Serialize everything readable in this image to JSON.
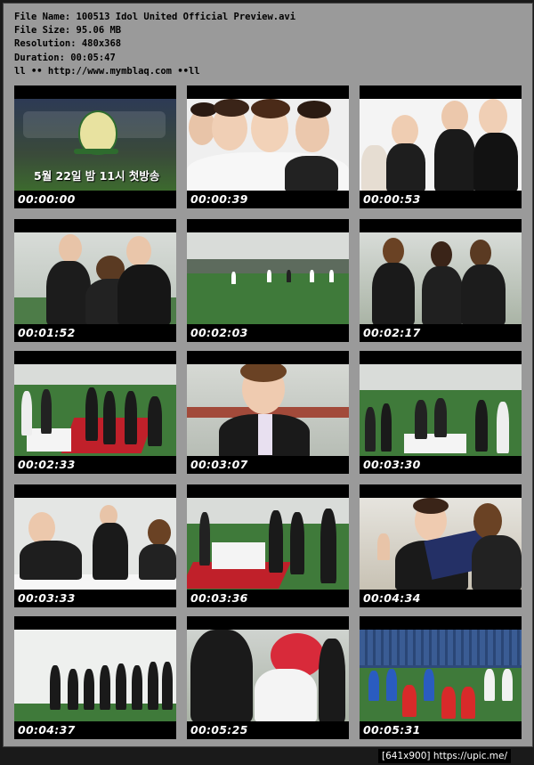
{
  "file_info": {
    "file_name": "File Name: 100513 Idol United Official Preview.avi",
    "file_size": "File Size: 95.06 MB",
    "resolution": "Resolution: 480x368",
    "duration": "Duration: 00:05:47",
    "url_line": "ll •• http://www.mymblaq.com ••ll"
  },
  "thumbnails": [
    {
      "time": "00:00:00",
      "caption": "5월 22일 밤 11시 첫방송"
    },
    {
      "time": "00:00:39"
    },
    {
      "time": "00:00:53"
    },
    {
      "time": "00:01:52"
    },
    {
      "time": "00:02:03"
    },
    {
      "time": "00:02:17"
    },
    {
      "time": "00:02:33"
    },
    {
      "time": "00:03:07"
    },
    {
      "time": "00:03:30"
    },
    {
      "time": "00:03:33"
    },
    {
      "time": "00:03:36"
    },
    {
      "time": "00:04:34"
    },
    {
      "time": "00:04:37"
    },
    {
      "time": "00:05:25"
    },
    {
      "time": "00:05:31"
    }
  ],
  "footer": {
    "text": "[641x900] https://upic.me/"
  },
  "colors": {
    "sheet_bg": "#9a9a9a",
    "thumb_bg": "#000000",
    "grass": "#3f7a3a",
    "carpet": "#c0202a"
  }
}
